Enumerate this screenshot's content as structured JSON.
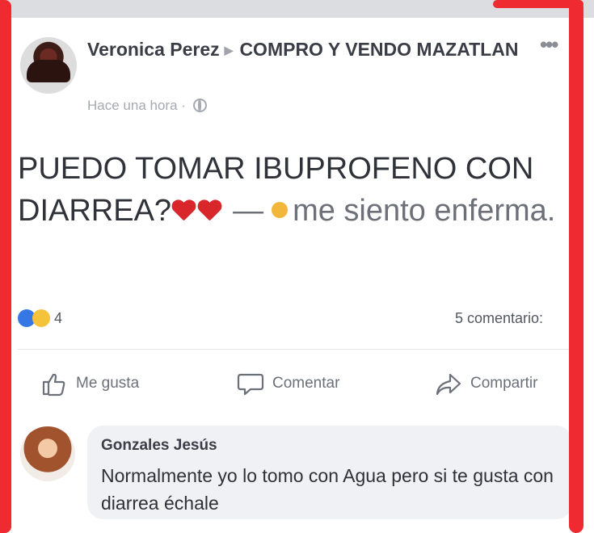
{
  "post": {
    "author": "Veronica Perez",
    "group": "COMPRO Y VENDO MAZATLAN",
    "timestamp": "Hace una hora ·",
    "text_main": "PUEDO TOMAR IBUPROFENO CON DIARREA?",
    "feeling_text": "me siento enferma.",
    "reaction_count": "4",
    "comment_count": "5 comentario:"
  },
  "actions": {
    "like": "Me gusta",
    "comment": "Comentar",
    "share": "Compartir"
  },
  "comment": {
    "author": "Gonzales Jesús",
    "text": "Normalmente yo lo tomo con Agua pero  si te gusta con diarrea échale"
  },
  "colors": {
    "marker_red": "#ef2a30",
    "like_blue": "#3578e5",
    "heart_red": "#d8262b"
  }
}
